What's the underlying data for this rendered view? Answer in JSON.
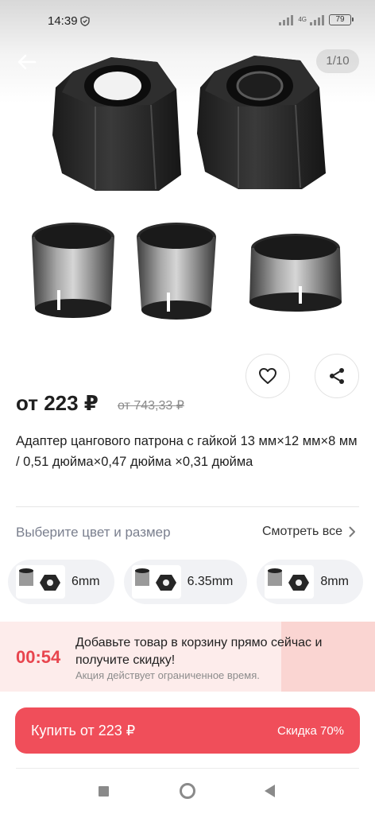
{
  "status": {
    "time": "14:39",
    "network": "4G",
    "battery": "79"
  },
  "gallery": {
    "counter": "1/10"
  },
  "product": {
    "price": "от 223 ₽",
    "old_price": "от 743,33 ₽",
    "title": "Адаптер цангового патрона с гайкой 13 мм×12 мм×8 мм / 0,51 дюйма×0,47 дюйма ×0,31 дюйма"
  },
  "variants": {
    "heading": "Выберите цвет и размер",
    "see_all": "Смотреть все",
    "items": [
      {
        "label": "6mm"
      },
      {
        "label": "6.35mm"
      },
      {
        "label": "8mm"
      }
    ]
  },
  "promo": {
    "timer": "00:54",
    "text": "Добавьте товар в корзину прямо сейчас и получите скидку!",
    "subtext": "Акция действует ограниченное время."
  },
  "buy": {
    "label": "Купить от 223 ₽",
    "discount": "Скидка 70%"
  },
  "colors": {
    "accent": "#f04e5a",
    "timer": "#e8454e",
    "promo_bg": "#fdeceb"
  },
  "icons": [
    "back-arrow-icon",
    "heart-icon",
    "share-icon",
    "chevron-right-icon",
    "shield-icon"
  ]
}
